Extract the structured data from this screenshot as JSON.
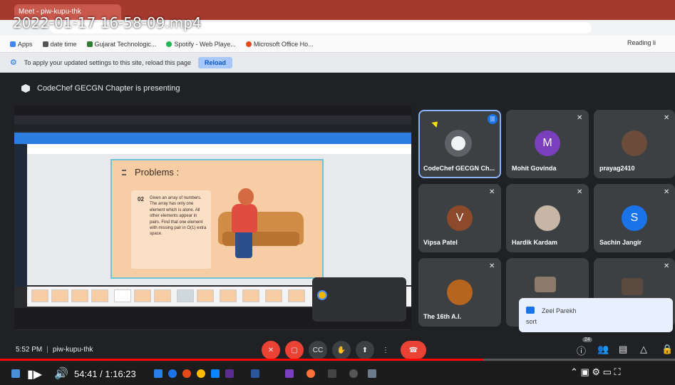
{
  "browser": {
    "tab_title": "Meet - piw-kupu-thk",
    "bookmarks": [
      {
        "label": "Apps",
        "color": "#4285f4"
      },
      {
        "label": "date time",
        "color": "#555555"
      },
      {
        "label": "Gujarat Technologic...",
        "color": "#2e7d32"
      },
      {
        "label": "Spotify - Web Playe...",
        "color": "#1db954"
      },
      {
        "label": "Microsoft Office Ho...",
        "color": "#e64a19"
      }
    ],
    "reading_list": "Reading li",
    "infobar_text": "To apply your updated settings to this site, reload this page",
    "reload_label": "Reload"
  },
  "video": {
    "title": "2022-01-17 16-58-09.mp4",
    "time_display": "54:41 / 1:16:23",
    "progress": 0.716
  },
  "meet": {
    "presenting_banner": "CodeChef GECGN Chapter is presenting",
    "slide": {
      "title": "Problems :",
      "number": "02",
      "text": "Given an array of numbers. The array has only one element which is alone. All other elements appear in pairs. Find that one element with missing pair in O(1) extra space."
    },
    "participants": [
      {
        "name": "CodeChef GECGN Ch...",
        "type": "logo"
      },
      {
        "name": "Mohit Govinda",
        "type": "letter",
        "letter": "M",
        "color": "#7b3fbd"
      },
      {
        "name": "prayag2410",
        "type": "photo",
        "color": "#6b4b3a"
      },
      {
        "name": "Vipsa Patel",
        "type": "letter",
        "letter": "V",
        "color": "#8d4a2b"
      },
      {
        "name": "Hardik Kardam",
        "type": "photo",
        "color": "#c7b6a6"
      },
      {
        "name": "Sachin Jangir",
        "type": "letter",
        "letter": "S",
        "color": "#1a73e8"
      },
      {
        "name": "The 16th A.I.",
        "type": "photo",
        "color": "#b5651d"
      },
      {
        "name": "",
        "type": "photo",
        "color": "#8c7a6a"
      },
      {
        "name": "",
        "type": "photo",
        "color": "#5a4a40"
      }
    ],
    "chat": {
      "sender": "Zeel Parekh",
      "message": "sort"
    },
    "clock": "5:52 PM",
    "room": "piw-kupu-thk",
    "people_count": "24"
  },
  "icons": [
    "hexagon-icon",
    "mic-off-icon",
    "camera-off-icon",
    "captions-icon",
    "raise-hand-icon",
    "present-icon",
    "more-icon",
    "end-call-icon",
    "info-icon",
    "people-icon",
    "chat-icon",
    "activities-icon",
    "host-controls-icon",
    "play-icon",
    "volume-icon"
  ],
  "colors": {
    "end_call": "#ea4335",
    "accent": "#1a73e8",
    "progress": "#ff0000"
  }
}
